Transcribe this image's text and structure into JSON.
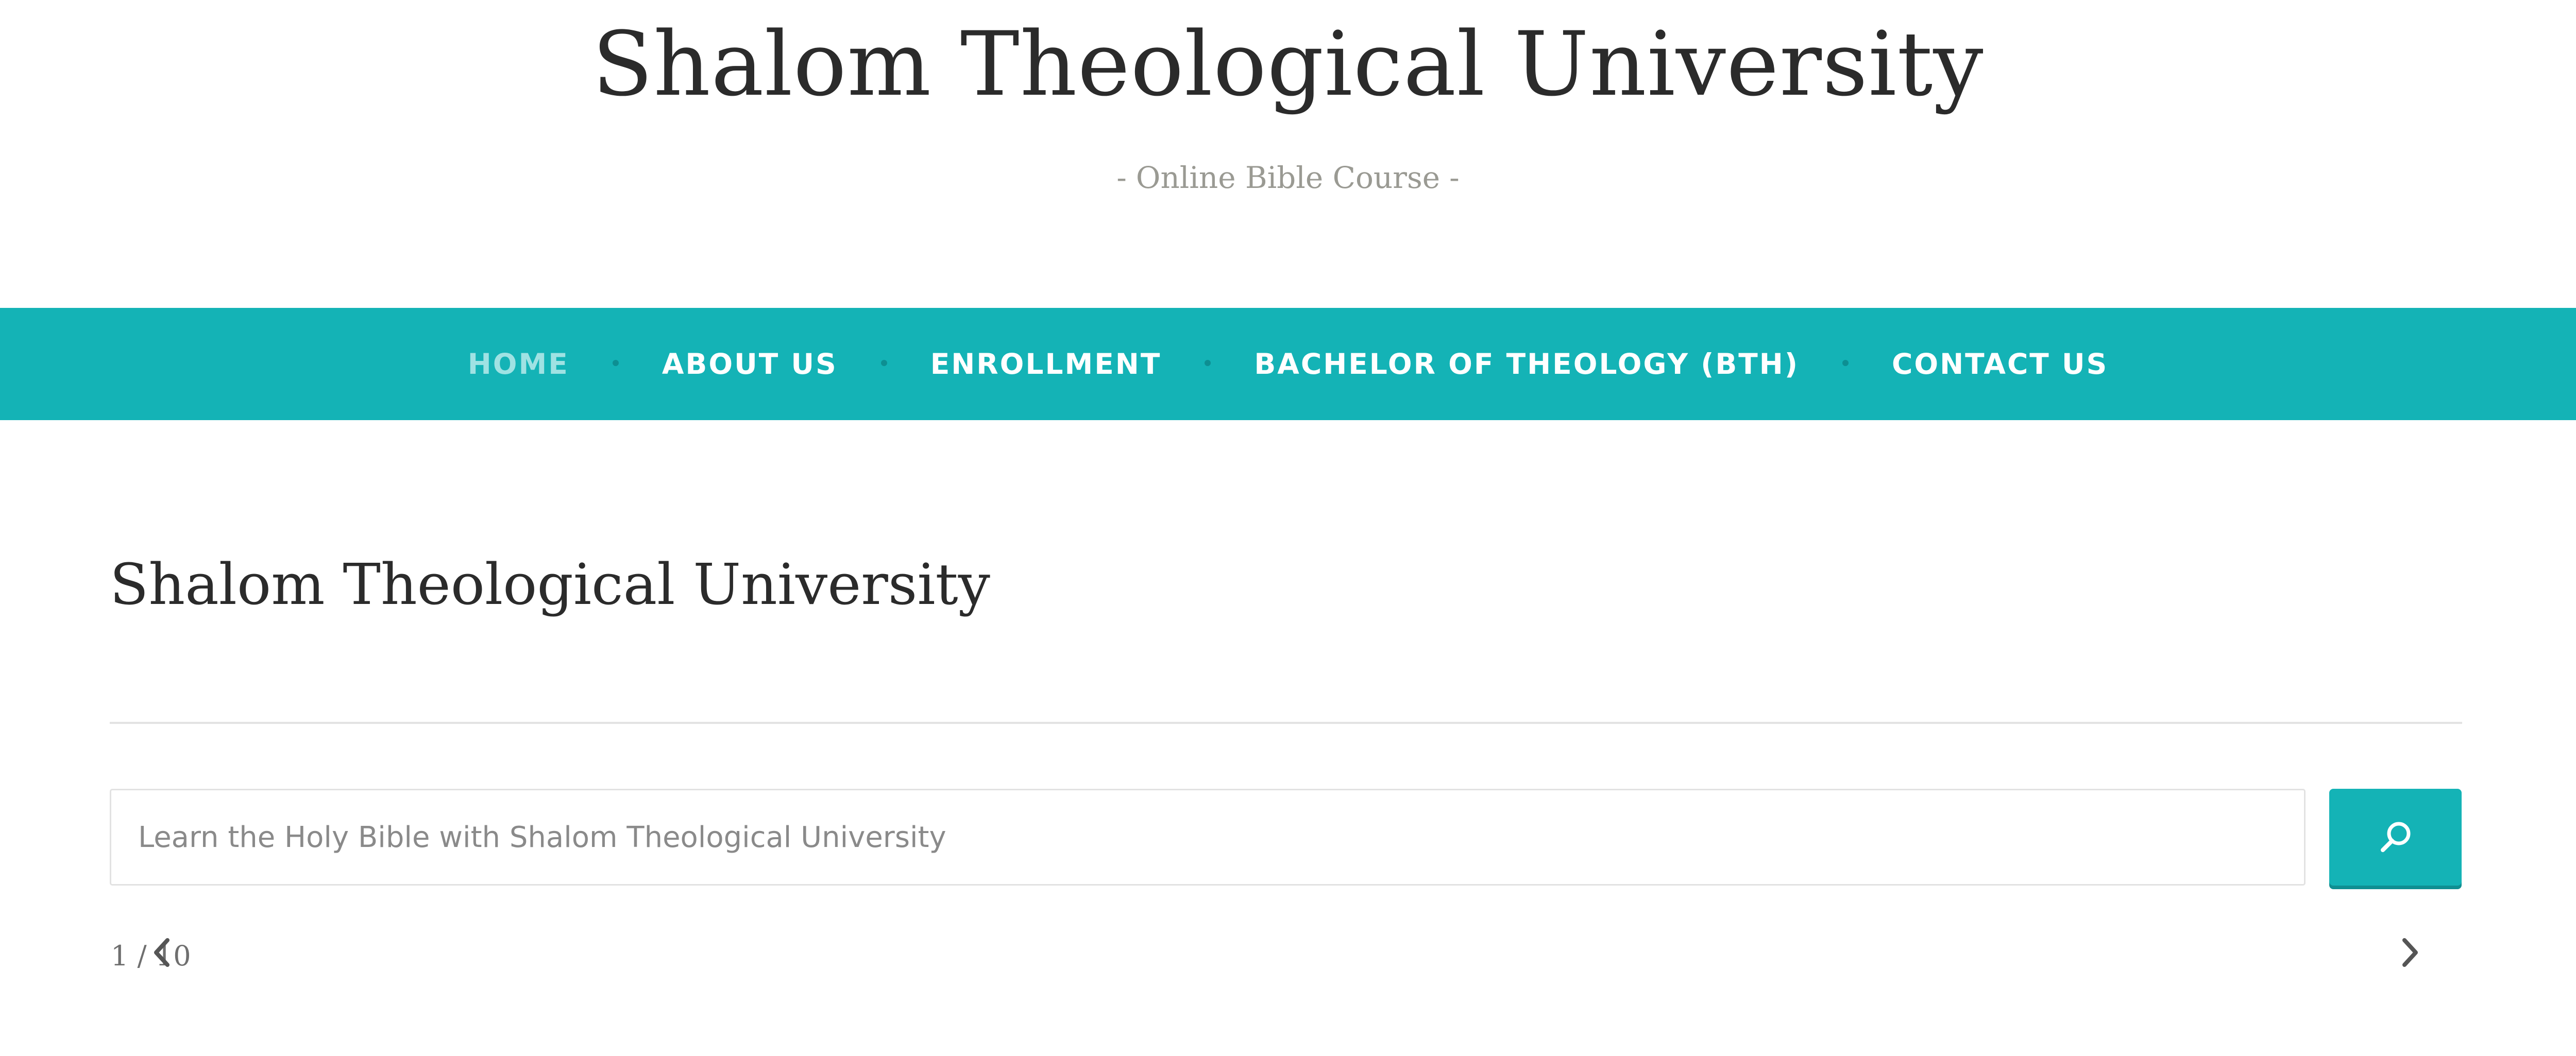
{
  "site": {
    "title": "Shalom Theological University",
    "tagline": "Online Bible Course",
    "tagline_dash": "-"
  },
  "nav": {
    "items": [
      {
        "label": "HOME",
        "active": true
      },
      {
        "label": "ABOUT US",
        "active": false
      },
      {
        "label": "ENROLLMENT",
        "active": false
      },
      {
        "label": "BACHELOR OF THEOLOGY (BTH)",
        "active": false
      },
      {
        "label": "CONTACT US",
        "active": false
      }
    ]
  },
  "main": {
    "page_title": "Shalom Theological University"
  },
  "search": {
    "placeholder": "Learn the Holy Bible with Shalom Theological University",
    "value": "",
    "button_icon": "search-icon"
  },
  "slider": {
    "counter": "1 / 10",
    "current": 1,
    "total": 10,
    "prev_icon": "chevron-left-icon",
    "next_icon": "chevron-right-icon"
  },
  "colors": {
    "accent": "#14b3b6",
    "accent_dark": "#0f8f92",
    "nav_active": "#9fe2e3",
    "nav_text": "#ffffff",
    "title_text": "#2b2b2b",
    "tagline_text": "#9a9a93"
  }
}
